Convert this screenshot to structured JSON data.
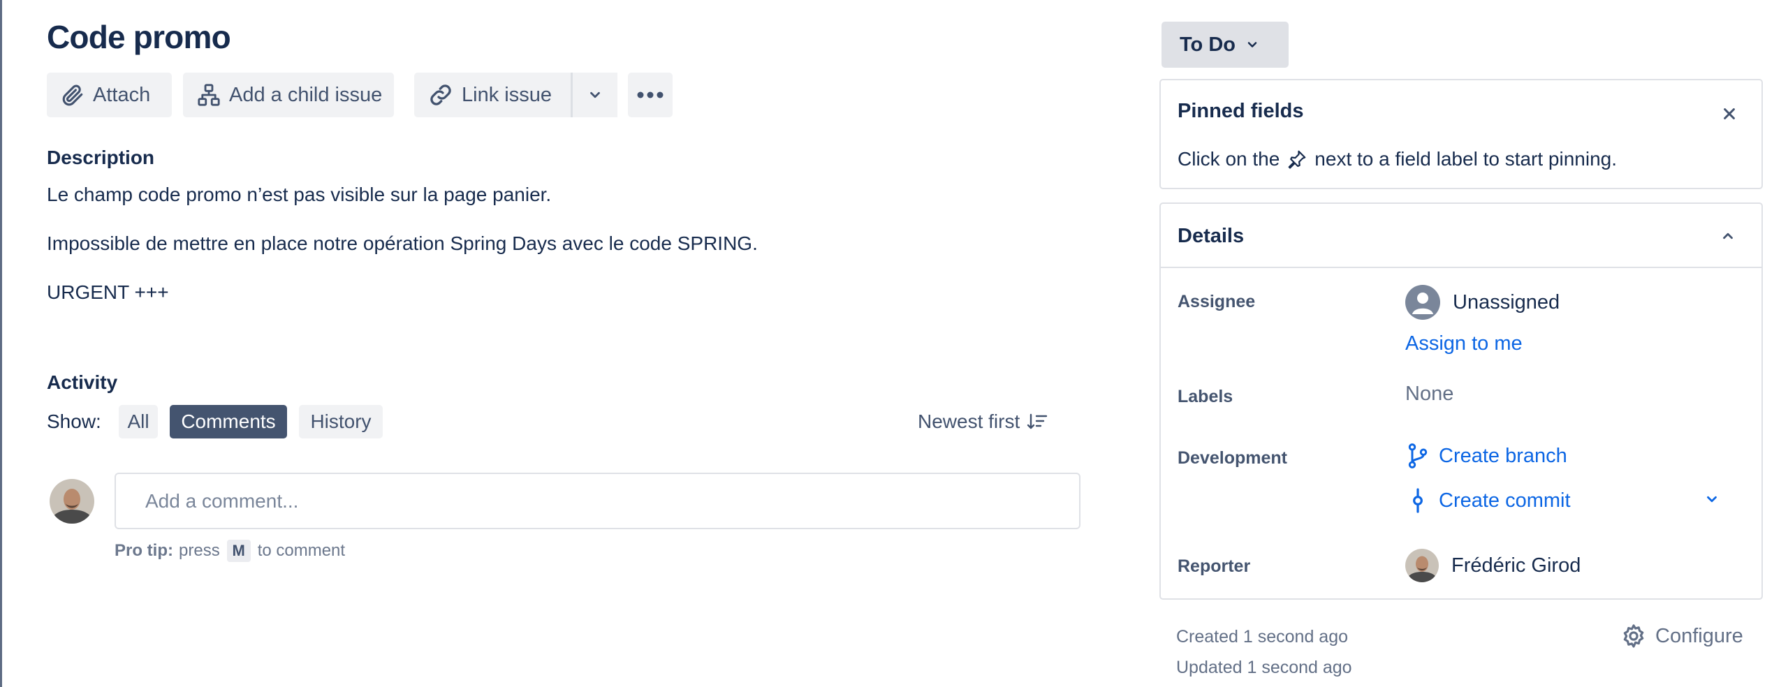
{
  "issue": {
    "title": "Code promo",
    "status": "To Do"
  },
  "toolbar": {
    "attach_label": "Attach",
    "add_child_label": "Add a child issue",
    "link_issue_label": "Link issue"
  },
  "description": {
    "heading": "Description",
    "paragraphs": [
      "Le champ code promo n’est pas visible sur la page panier.",
      "Impossible de mettre en place notre opération Spring Days avec le code SPRING.",
      "URGENT +++"
    ]
  },
  "activity": {
    "heading": "Activity",
    "show_label": "Show:",
    "filters": [
      "All",
      "Comments",
      "History"
    ],
    "active_filter": "Comments",
    "sort_label": "Newest first",
    "comment_placeholder": "Add a comment...",
    "protip_bold": "Pro tip:",
    "protip_pre": "press",
    "protip_key": "M",
    "protip_post": "to comment"
  },
  "pinned": {
    "title": "Pinned fields",
    "text_before": "Click on the",
    "text_after": "next to a field label to start pinning."
  },
  "details": {
    "title": "Details",
    "assignee_label": "Assignee",
    "assignee_value": "Unassigned",
    "assign_to_me": "Assign to me",
    "labels_label": "Labels",
    "labels_value": "None",
    "development_label": "Development",
    "create_branch": "Create branch",
    "create_commit": "Create commit",
    "reporter_label": "Reporter",
    "reporter_value": "Frédéric Girod"
  },
  "meta": {
    "created": "Created 1 second ago",
    "updated": "Updated 1 second ago",
    "configure": "Configure"
  },
  "colors": {
    "text_primary": "#172b4d",
    "link": "#0c66e4",
    "active_chip": "#44546f",
    "button_bg": "#f1f2f4",
    "status_bg": "#dfe1e6"
  },
  "icons": [
    "paperclip-icon",
    "hierarchy-icon",
    "link-icon",
    "chevron-down-icon",
    "more-icon",
    "sort-icon",
    "close-icon",
    "pin-icon",
    "chevron-up-icon",
    "branch-icon",
    "commit-icon",
    "gear-icon"
  ]
}
